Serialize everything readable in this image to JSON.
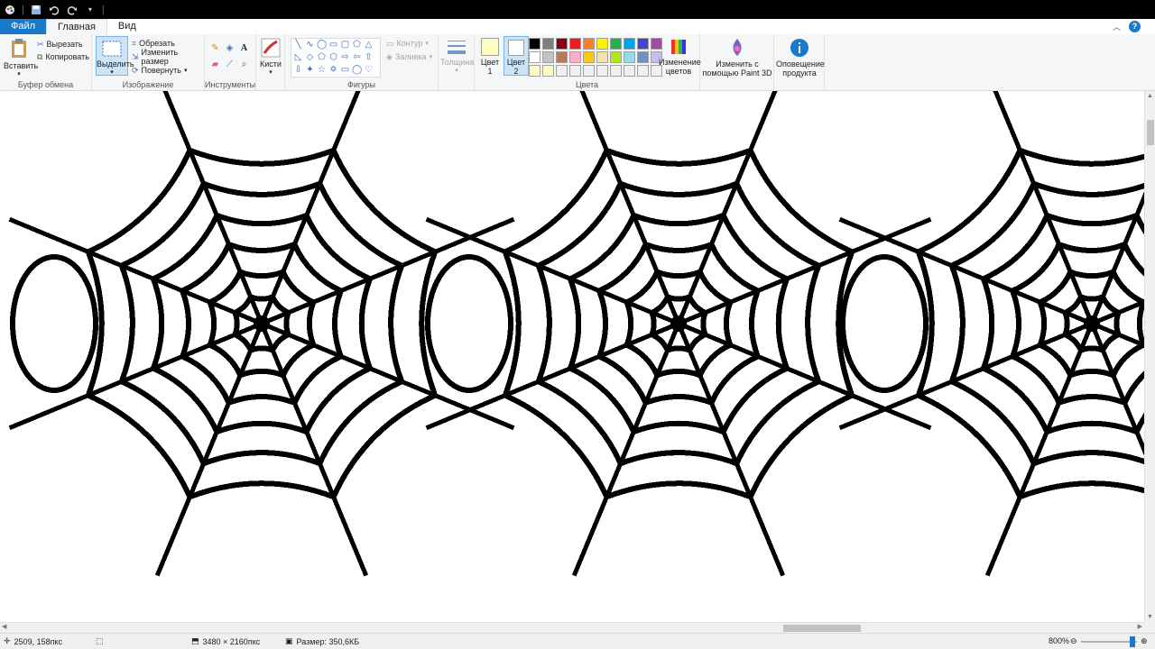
{
  "tabs": {
    "file": "Файл",
    "home": "Главная",
    "view": "Вид"
  },
  "clipboard": {
    "paste": "Вставить",
    "cut": "Вырезать",
    "copy": "Копировать",
    "label": "Буфер обмена"
  },
  "image": {
    "select": "Выделить",
    "crop": "Обрезать",
    "resize": "Изменить размер",
    "rotate": "Повернуть",
    "label": "Изображение"
  },
  "tools": {
    "label": "Инструменты"
  },
  "brushes": {
    "label": "Кисти"
  },
  "shapes": {
    "outline": "Контур",
    "fill": "Заливка",
    "label": "Фигуры"
  },
  "thickness": {
    "label": "Толщина"
  },
  "colors": {
    "color1": "Цвет 1",
    "color2": "Цвет 2",
    "edit": "Изменение цветов",
    "label": "Цвета",
    "color1_value": "#fffcc0",
    "color2_value": "#ffffff",
    "palette_row1": [
      "#000000",
      "#7f7f7f",
      "#880015",
      "#ed1c24",
      "#ff7f27",
      "#fff200",
      "#22b14c",
      "#00a2e8",
      "#3f48cc",
      "#a349a4"
    ],
    "palette_row2": [
      "#ffffff",
      "#c3c3c3",
      "#b97a57",
      "#ffaec9",
      "#ffc90e",
      "#efe4b0",
      "#b5e61d",
      "#99d9ea",
      "#7092be",
      "#c8bfe7"
    ],
    "palette_row3": [
      "#fffcc0",
      "#fffcc0",
      "#f0f0f0",
      "#f0f0f0",
      "#f0f0f0",
      "#f0f0f0",
      "#f0f0f0",
      "#f0f0f0",
      "#f0f0f0",
      "#f0f0f0"
    ]
  },
  "paint3d": {
    "label": "Изменить с помощью Paint 3D"
  },
  "alert": {
    "label": "Оповещение продукта"
  },
  "status": {
    "cursor": "2509, 158пкс",
    "dimensions": "3480 × 2160пкс",
    "size": "Размер: 350,6КБ",
    "zoom": "800%"
  }
}
